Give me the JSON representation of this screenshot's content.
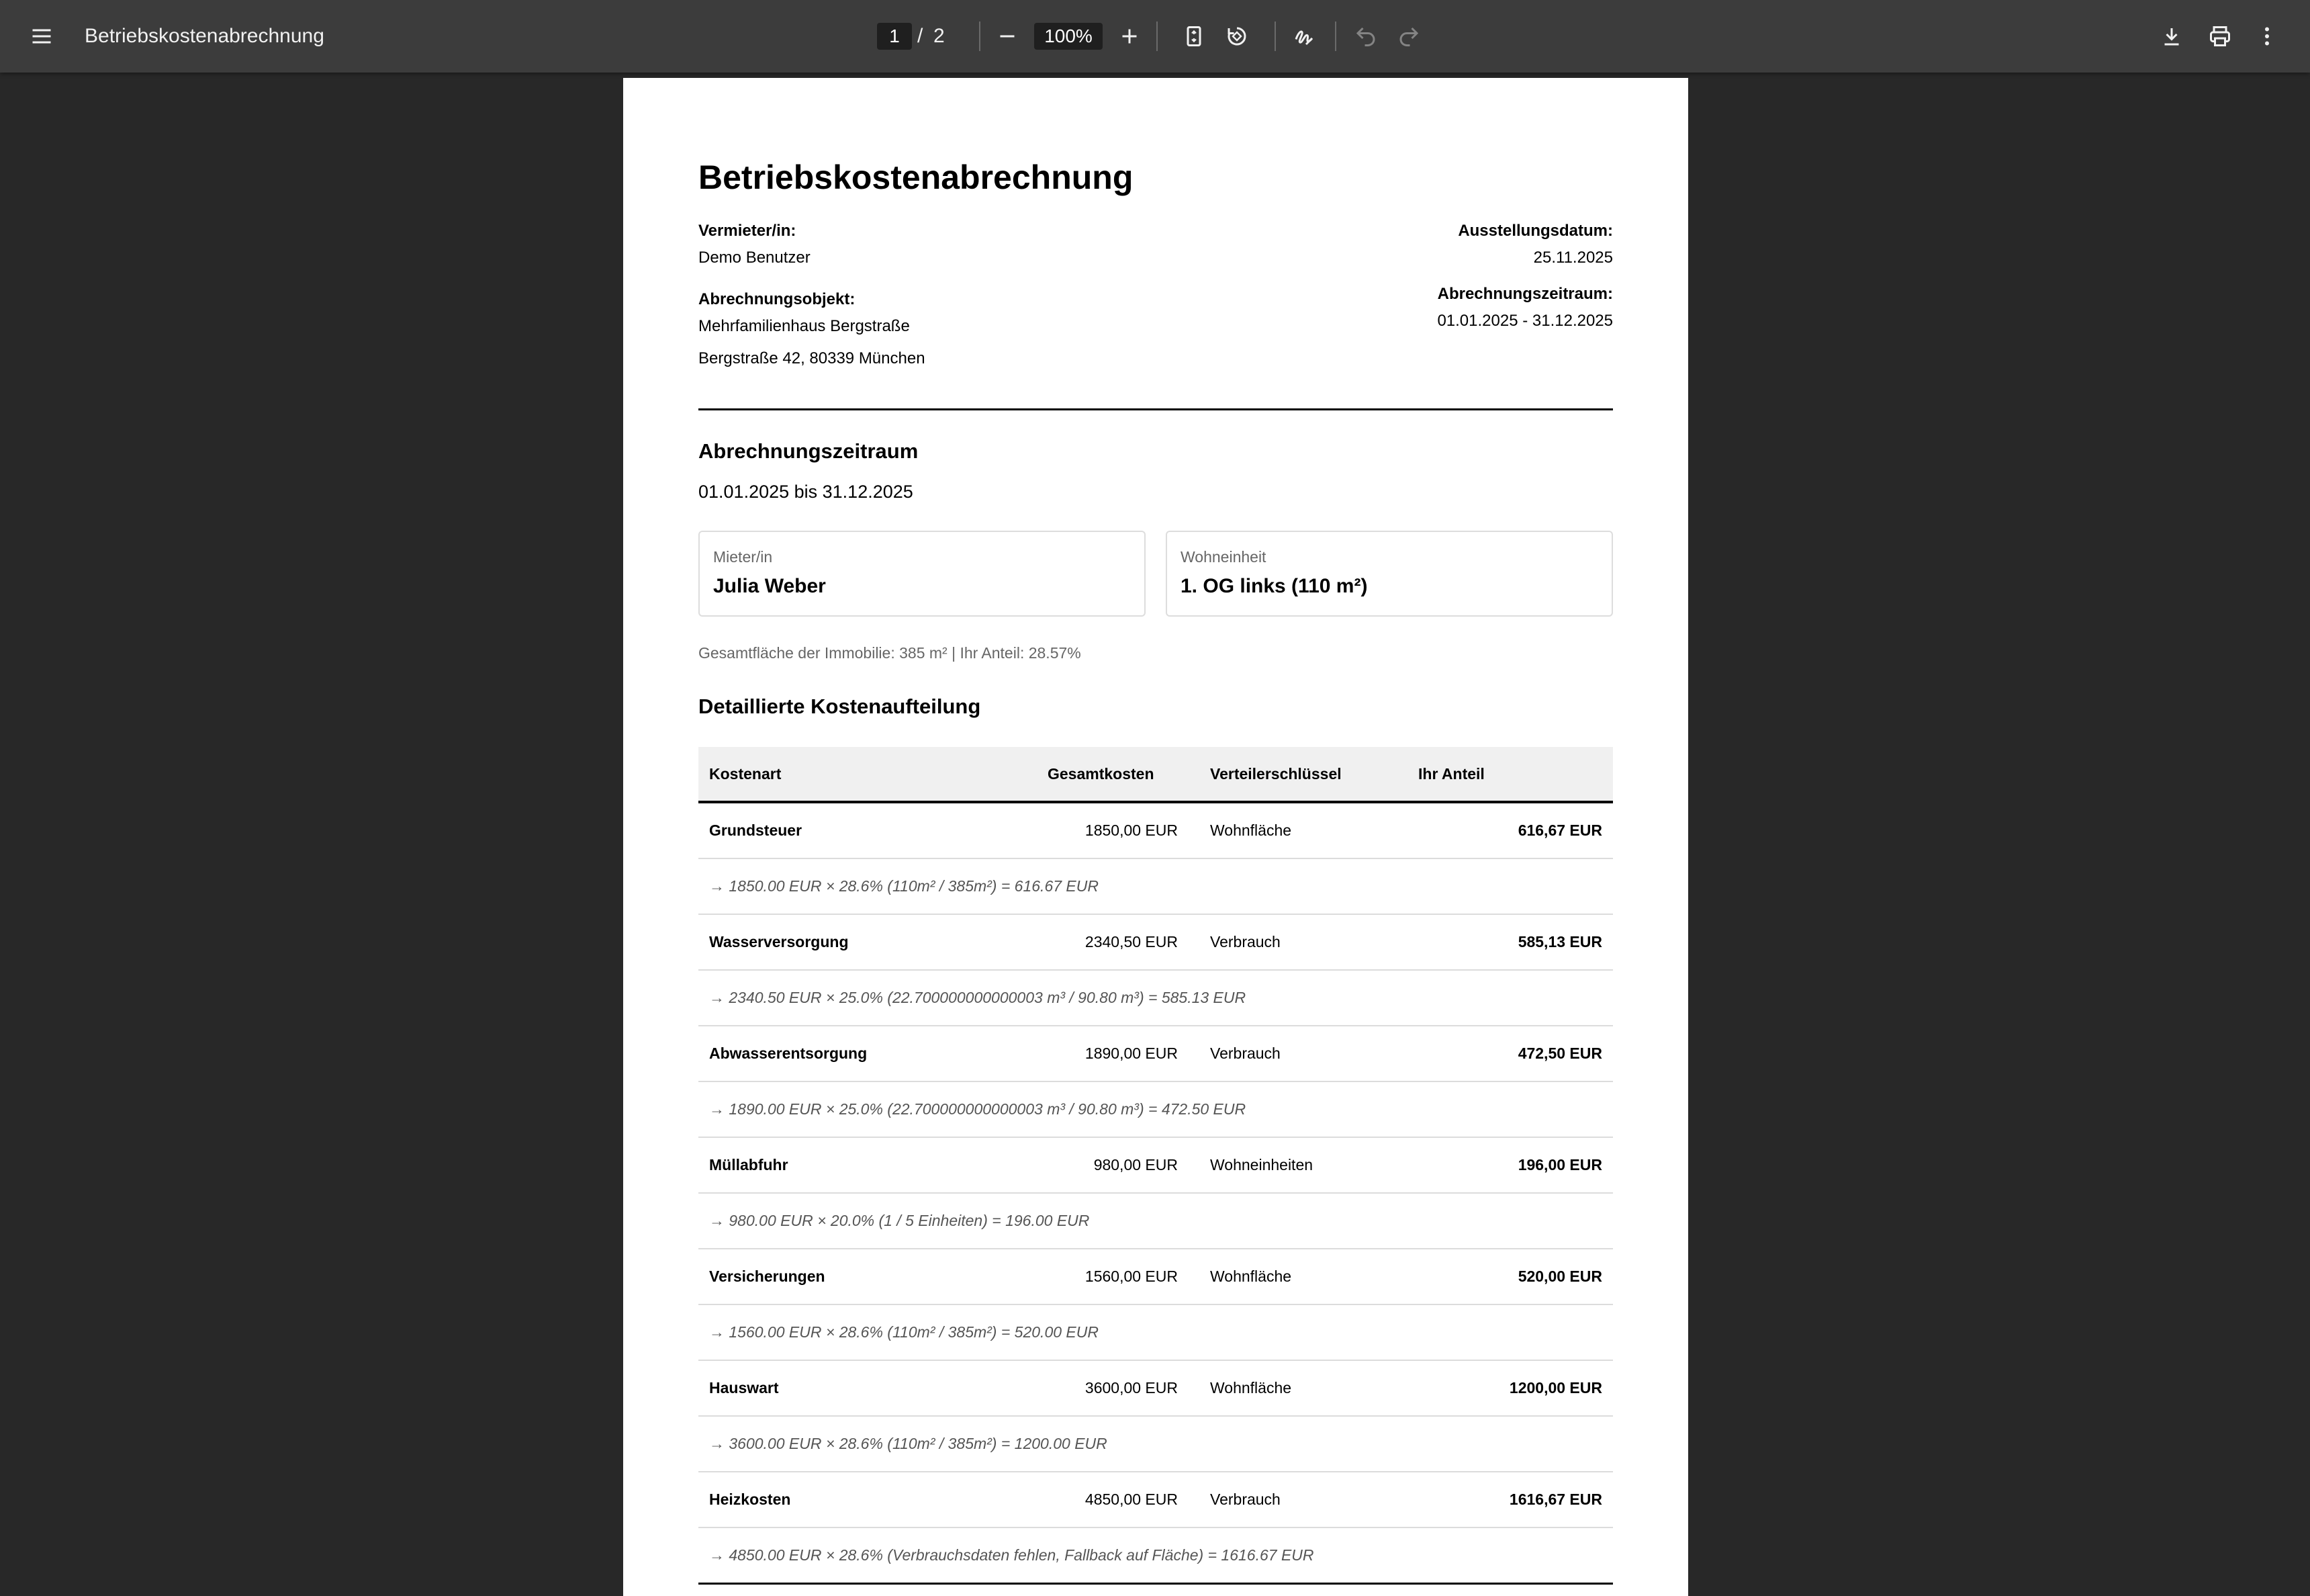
{
  "toolbar": {
    "title": "Betriebskostenabrechnung",
    "page_current": "1",
    "page_sep": "/",
    "page_total": "2",
    "zoom": "100%"
  },
  "doc": {
    "title": "Betriebskostenabrechnung",
    "landlord_label": "Vermieter/in:",
    "landlord_value": "Demo Benutzer",
    "object_label": "Abrechnungsobjekt:",
    "object_line1": "Mehrfamilienhaus Bergstraße",
    "object_line2": "Bergstraße 42, 80339 München",
    "issue_label": "Ausstellungsdatum:",
    "issue_value": "25.11.2025",
    "period_label": "Abrechnungszeitraum:",
    "period_value": "01.01.2025 - 31.12.2025",
    "section_period_title": "Abrechnungszeitraum",
    "section_period_text": "01.01.2025 bis 31.12.2025",
    "tenant_label": "Mieter/in",
    "tenant_value": "Julia Weber",
    "unit_label": "Wohneinheit",
    "unit_value": "1. OG links (110 m²)",
    "area_info": "Gesamtfläche der Immobilie: 385 m² | Ihr Anteil: 28.57%",
    "section_costs_title": "Detaillierte Kostenaufteilung",
    "table": {
      "headers": [
        "Kostenart",
        "Gesamtkosten",
        "Verteilerschlüssel",
        "Ihr Anteil"
      ],
      "rows": [
        {
          "name": "Grundsteuer",
          "total": "1850,00 EUR",
          "key": "Wohnfläche",
          "share": "616,67 EUR",
          "calc": "→ 1850.00 EUR × 28.6% (110m² / 385m²) = 616.67 EUR"
        },
        {
          "name": "Wasserversorgung",
          "total": "2340,50 EUR",
          "key": "Verbrauch",
          "share": "585,13 EUR",
          "calc": "→ 2340.50 EUR × 25.0% (22.700000000000003 m³ / 90.80 m³) = 585.13 EUR"
        },
        {
          "name": "Abwasserentsorgung",
          "total": "1890,00 EUR",
          "key": "Verbrauch",
          "share": "472,50 EUR",
          "calc": "→ 1890.00 EUR × 25.0% (22.700000000000003 m³ / 90.80 m³) = 472.50 EUR"
        },
        {
          "name": "Müllabfuhr",
          "total": "980,00 EUR",
          "key": "Wohneinheiten",
          "share": "196,00 EUR",
          "calc": "→ 980.00 EUR × 20.0% (1 / 5 Einheiten) = 196.00 EUR"
        },
        {
          "name": "Versicherungen",
          "total": "1560,00 EUR",
          "key": "Wohnfläche",
          "share": "520,00 EUR",
          "calc": "→ 1560.00 EUR × 28.6% (110m² / 385m²) = 520.00 EUR"
        },
        {
          "name": "Hauswart",
          "total": "3600,00 EUR",
          "key": "Wohnfläche",
          "share": "1200,00 EUR",
          "calc": "→ 3600.00 EUR × 28.6% (110m² / 385m²) = 1200.00 EUR"
        },
        {
          "name": "Heizkosten",
          "total": "4850,00 EUR",
          "key": "Verbrauch",
          "share": "1616,67 EUR",
          "calc": "→ 4850.00 EUR × 28.6% (Verbrauchsdaten fehlen, Fallback auf Fläche) = 1616.67 EUR"
        }
      ]
    }
  }
}
